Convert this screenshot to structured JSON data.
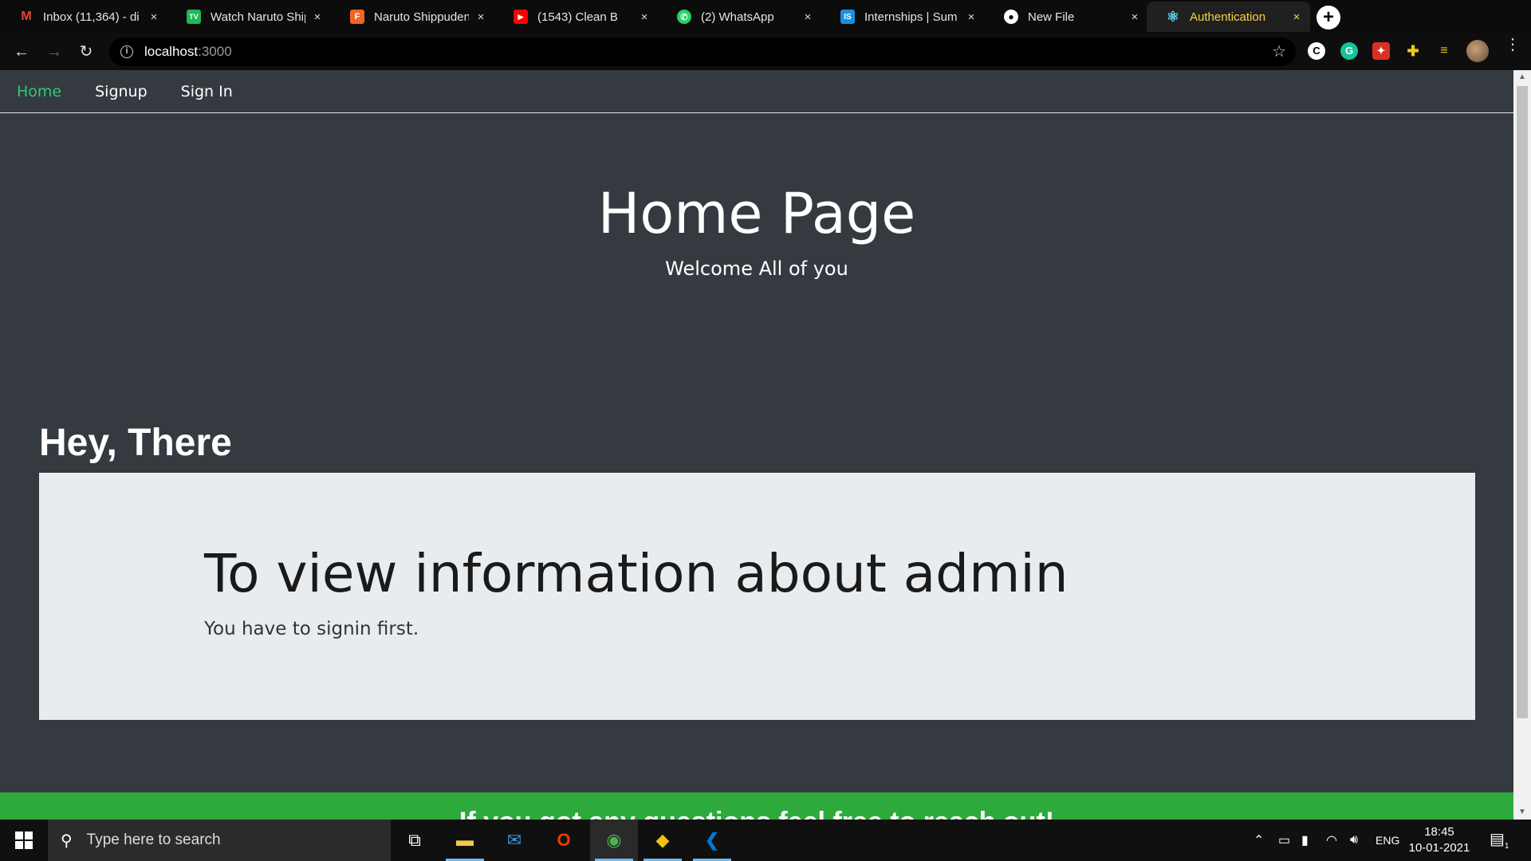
{
  "browser": {
    "tabs": [
      {
        "title": "Inbox (11,364) - di",
        "favicon": "gmail-icon",
        "color": "#ea4335",
        "glyph": "M",
        "active": false
      },
      {
        "title": "Watch Naruto Ship",
        "favicon": "tv-icon",
        "color": "#1db954",
        "glyph": "TV",
        "active": false
      },
      {
        "title": "Naruto Shippuden",
        "favicon": "f-icon",
        "color": "#f26522",
        "glyph": "F",
        "active": false
      },
      {
        "title": "(1543) Clean B",
        "favicon": "youtube-icon",
        "color": "#ff0000",
        "glyph": "▶",
        "active": false
      },
      {
        "title": "(2) WhatsApp",
        "favicon": "whatsapp-icon",
        "color": "#25d366",
        "glyph": "✆",
        "active": false
      },
      {
        "title": "Internships | Sum",
        "favicon": "internshala-icon",
        "color": "#1a8fe3",
        "glyph": "IS",
        "active": false
      },
      {
        "title": "New File",
        "favicon": "github-icon",
        "color": "#333333",
        "glyph": "●",
        "active": false
      },
      {
        "title": "Authentication",
        "favicon": "react-icon",
        "color": "#61dafb",
        "glyph": "⚛",
        "active": true
      }
    ],
    "new_tab": "+",
    "close_glyph": "×",
    "address": {
      "host": "localhost",
      "port": ":3000"
    }
  },
  "site": {
    "nav": [
      {
        "label": "Home",
        "active": true
      },
      {
        "label": "Signup",
        "active": false
      },
      {
        "label": "Sign In",
        "active": false
      }
    ],
    "hero_title": "Home Page",
    "hero_subtitle": "Welcome All of you",
    "section_heading": "Hey, There",
    "jumbotron": {
      "title": "To view information about admin",
      "text": "You have to signin first."
    },
    "footer_text": "If you got any questions feel free to reach out!"
  },
  "taskbar": {
    "search_placeholder": "Type here to search",
    "language": "ENG",
    "time": "18:45",
    "date": "10-01-2021",
    "notification_count": "1"
  },
  "colors": {
    "page_bg": "#343a40",
    "nav_active": "#2ecc71",
    "jumbotron_bg": "#e9ecef",
    "footer_bg": "#2eaa3d",
    "active_tab_text": "#f5d44a"
  }
}
